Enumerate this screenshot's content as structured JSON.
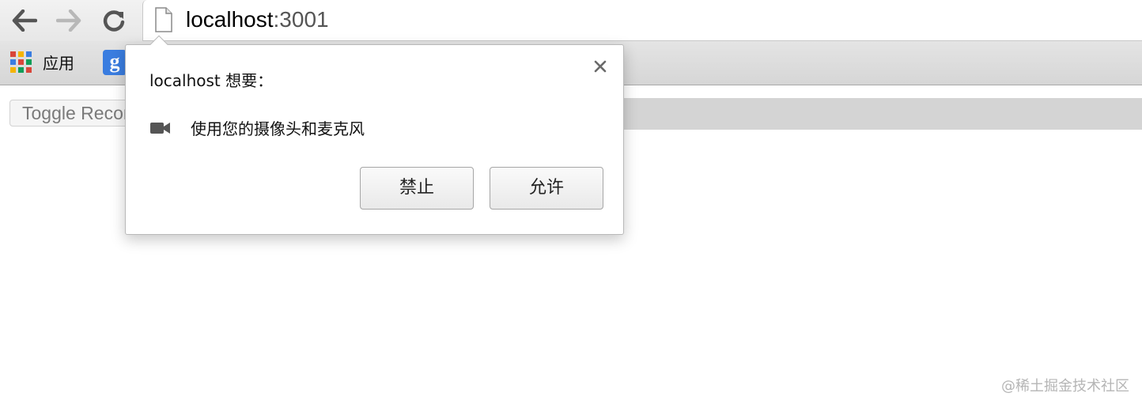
{
  "browser": {
    "url_host": "localhost",
    "url_port": ":3001"
  },
  "bookmarks_bar": {
    "apps_label": "应用",
    "google_bookmark_letter": "g"
  },
  "page": {
    "toggle_button_label": "Toggle Recording"
  },
  "permission_dialog": {
    "title": "localhost 想要：",
    "permission_text": "使用您的摄像头和麦克风",
    "block_label": "禁止",
    "allow_label": "允许"
  },
  "watermark": "@稀土掘金技术社区",
  "colors": {
    "accent_blue": "#3a7de0",
    "apps_grid": [
      "#d9463a",
      "#f4b400",
      "#3b7de0",
      "#0f9d58"
    ]
  },
  "icons": {
    "back": "back-arrow-icon",
    "forward": "forward-arrow-icon",
    "reload": "reload-icon",
    "page": "page-icon",
    "apps": "apps-grid-icon",
    "close": "close-icon",
    "camera": "camera-icon"
  }
}
